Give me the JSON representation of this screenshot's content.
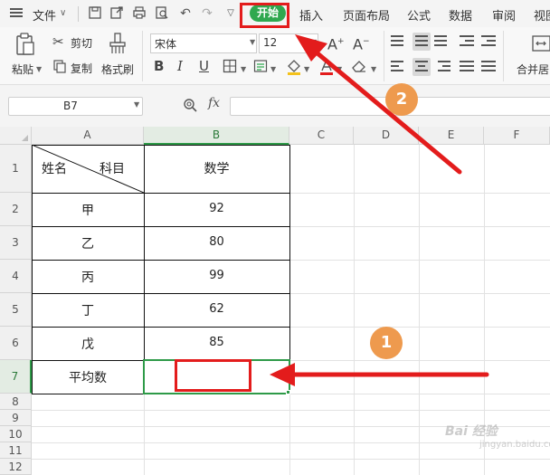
{
  "menubar": {
    "file_label": "文件",
    "tabs": [
      {
        "label": "开始",
        "active": true
      },
      {
        "label": "插入"
      },
      {
        "label": "页面布局"
      },
      {
        "label": "公式"
      },
      {
        "label": "数据"
      },
      {
        "label": "审阅"
      },
      {
        "label": "视图"
      }
    ],
    "active_tab_color": "#2fa84f"
  },
  "ribbon": {
    "paste_label": "粘贴",
    "cut_label": "剪切",
    "copy_label": "复制",
    "format_painter_label": "格式刷",
    "font_name": "宋体",
    "font_size": "12",
    "bold_glyph": "B",
    "italic_glyph": "I",
    "underline_glyph": "U",
    "grow_font_glyph": "A+",
    "shrink_font_glyph": "A-",
    "merge_center_label": "合并居中"
  },
  "formula_bar": {
    "name_box": "B7",
    "fx_label": "fx",
    "formula_value": ""
  },
  "sheet": {
    "columns": [
      "A",
      "B",
      "C",
      "D",
      "E",
      "F"
    ],
    "rows": [
      "1",
      "2",
      "3",
      "4",
      "5",
      "6",
      "7",
      "8",
      "9",
      "10",
      "11",
      "12"
    ],
    "selected_cell": "B7",
    "header": {
      "diagonal_left": "姓名",
      "diagonal_right": "科目",
      "math": "数学"
    },
    "records": [
      {
        "name": "甲",
        "score": "92"
      },
      {
        "name": "乙",
        "score": "80"
      },
      {
        "name": "丙",
        "score": "99"
      },
      {
        "name": "丁",
        "score": "62"
      },
      {
        "name": "戊",
        "score": "85"
      }
    ],
    "average_label": "平均数",
    "average_value": ""
  },
  "annotations": {
    "step1": "1",
    "step2": "2",
    "arrow_color": "#e31c1c",
    "badge_color": "#ee9a4e"
  },
  "watermark": {
    "text": "Bai 经验",
    "sub": "jingyan.baidu.com"
  }
}
